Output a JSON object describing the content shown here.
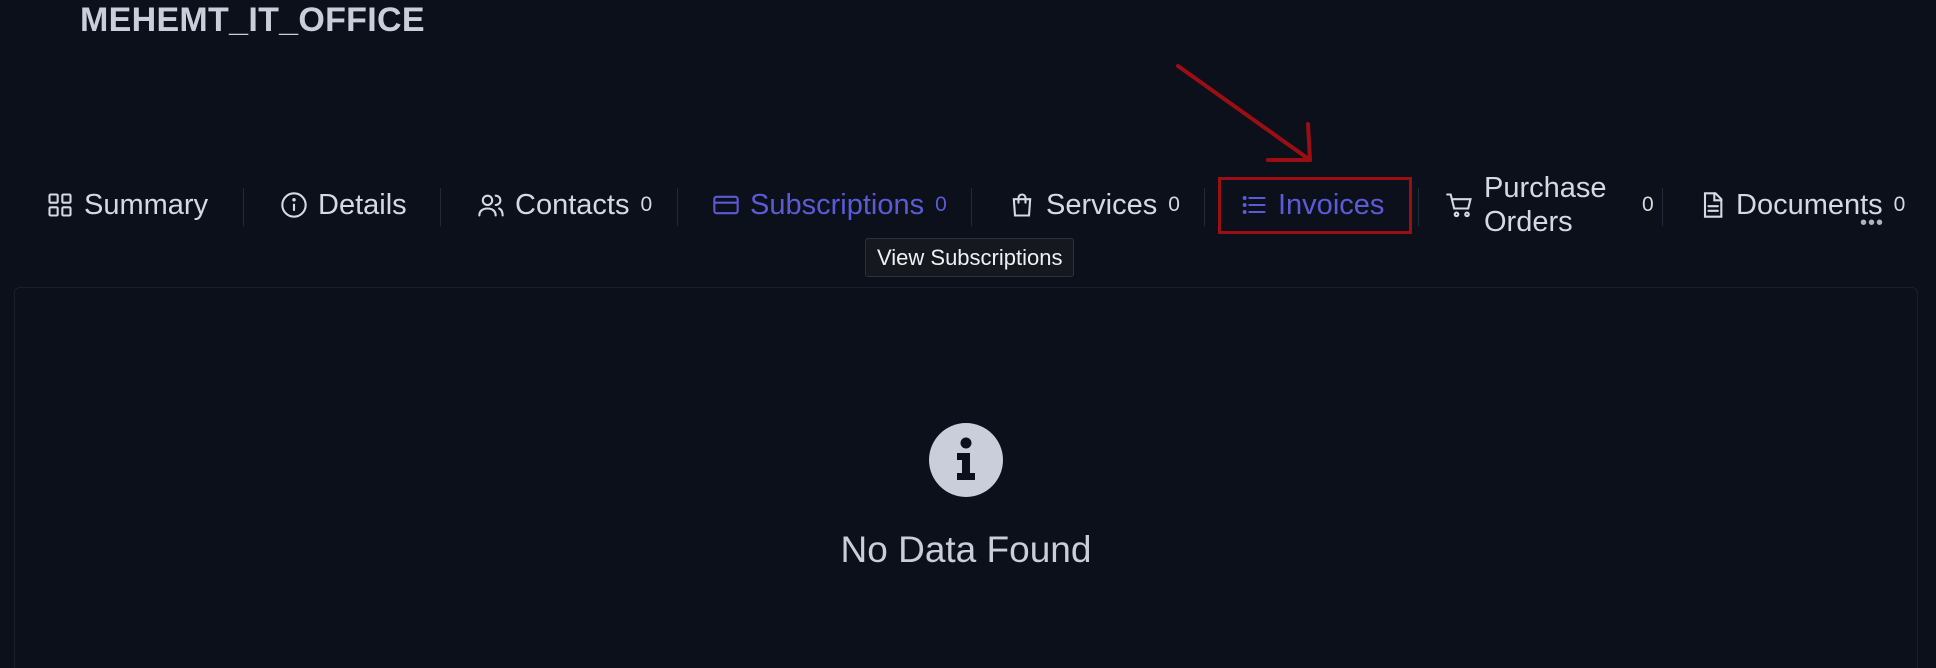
{
  "page": {
    "title": "MEHEMT_IT_OFFICE"
  },
  "tabs": [
    {
      "key": "summary",
      "label": "Summary",
      "icon": "grid-icon",
      "count": null
    },
    {
      "key": "details",
      "label": "Details",
      "icon": "info-circle-icon",
      "count": null
    },
    {
      "key": "contacts",
      "label": "Contacts",
      "icon": "users-icon",
      "count": "0"
    },
    {
      "key": "subscriptions",
      "label": "Subscriptions",
      "icon": "credit-card-icon",
      "count": "0"
    },
    {
      "key": "services",
      "label": "Services",
      "icon": "shopping-bag-icon",
      "count": "0"
    },
    {
      "key": "invoices",
      "label": "Invoices",
      "icon": "list-icon",
      "count": null
    },
    {
      "key": "purchase_orders",
      "label": "Purchase Orders",
      "icon": "cart-icon",
      "count": "0"
    },
    {
      "key": "documents",
      "label": "Documents",
      "icon": "file-icon",
      "count": "0"
    }
  ],
  "tooltip": {
    "text": "View Subscriptions"
  },
  "empty_state": {
    "icon": "info-icon",
    "message": "No Data Found"
  },
  "colors": {
    "background": "#0b101b",
    "accent": "#5b5bd6",
    "annotation": "#9b0e13",
    "text": "#d5d9e2"
  }
}
